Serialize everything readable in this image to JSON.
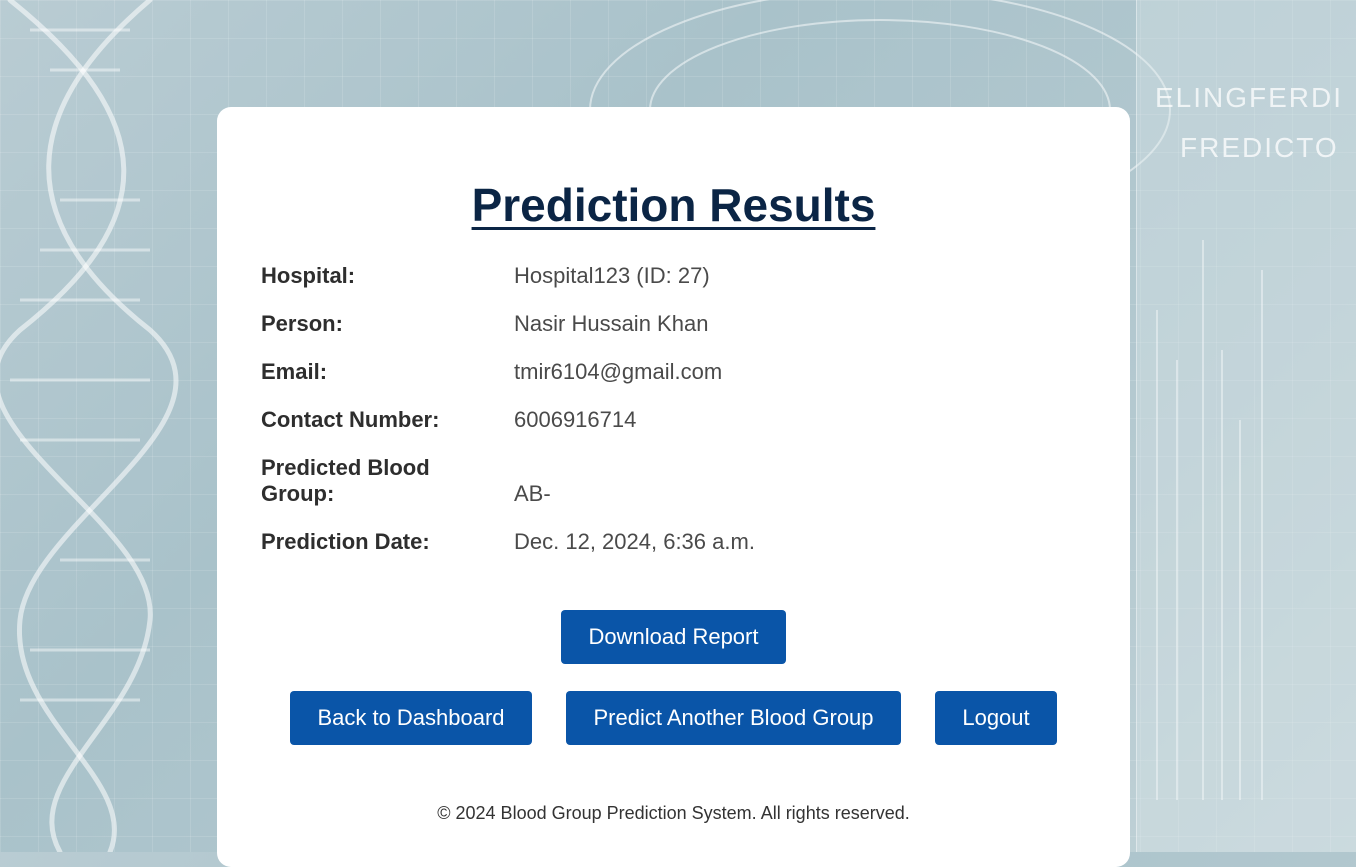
{
  "background": {
    "panel_text_line1": "ELINGFERDI",
    "panel_text_line2": "FREDICTO"
  },
  "page": {
    "title": "Prediction Results"
  },
  "details": [
    {
      "label": "Hospital:",
      "value": "Hospital123 (ID: 27)"
    },
    {
      "label": "Person:",
      "value": "Nasir Hussain Khan"
    },
    {
      "label": "Email:",
      "value": "tmir6104@gmail.com"
    },
    {
      "label": "Contact Number:",
      "value": "6006916714"
    },
    {
      "label_line1": "Predicted Blood",
      "label_line2": "Group:",
      "value": "AB-"
    },
    {
      "label": "Prediction Date:",
      "value": "Dec. 12, 2024, 6:36 a.m."
    }
  ],
  "actions": {
    "download_label": "Download Report",
    "back_label": "Back to Dashboard",
    "predict_label": "Predict Another Blood Group",
    "logout_label": "Logout"
  },
  "footer": {
    "text": "© 2024 Blood Group Prediction System. All rights reserved."
  },
  "colors": {
    "accent": "#0a55a8",
    "title": "#0b2545"
  }
}
